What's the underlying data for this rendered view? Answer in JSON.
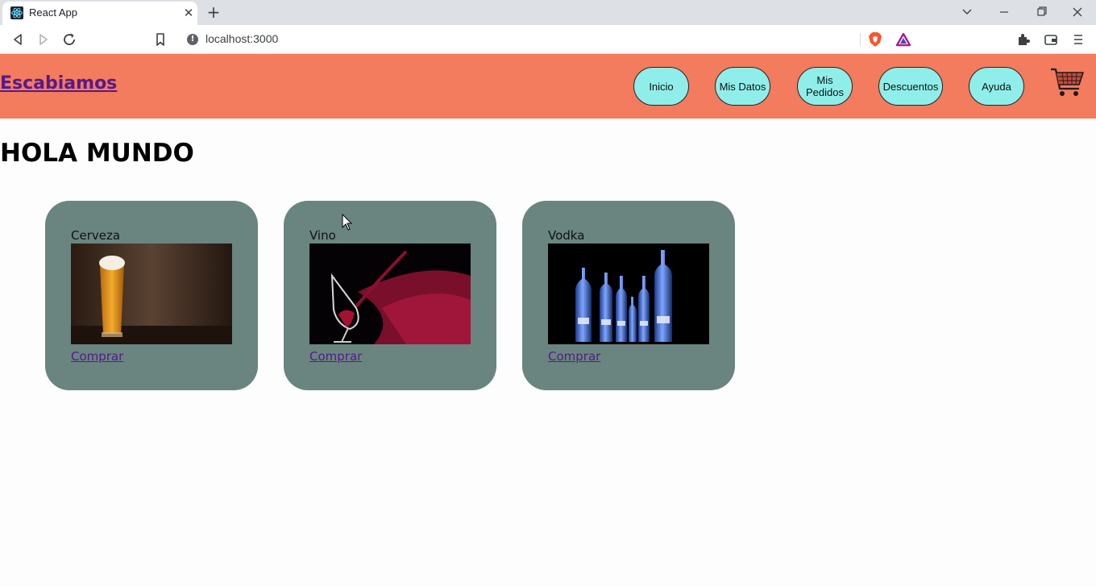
{
  "browser": {
    "tab_title": "React App",
    "tab_close": "✕",
    "new_tab": "+",
    "url": "localhost:3000"
  },
  "header": {
    "brand": "Escabiamos",
    "nav": [
      {
        "label": "Inicio"
      },
      {
        "label": "Mis Datos"
      },
      {
        "label": "Mis Pedidos"
      },
      {
        "label": "Descuentos"
      },
      {
        "label": "Ayuda"
      }
    ],
    "cart_icon": "shopping-cart-icon",
    "background_color": "#f37b5e",
    "button_color": "#8feeea"
  },
  "main": {
    "title": "HOLA MUNDO",
    "card_color": "#6a8580",
    "products": [
      {
        "name": "Cerveza",
        "link": "Comprar",
        "image": "beer-glass-photo"
      },
      {
        "name": "Vino",
        "link": "Comprar",
        "image": "wine-glass-photo"
      },
      {
        "name": "Vodka",
        "link": "Comprar",
        "image": "vodka-bottles-photo"
      }
    ]
  }
}
